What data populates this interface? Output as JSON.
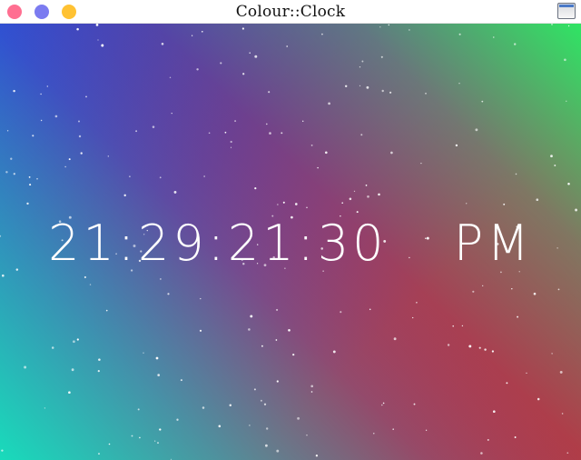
{
  "window": {
    "title": "Colour::Clock",
    "controls": {
      "close_color": "#ff6f91",
      "minimize_color": "#7b7bf0",
      "zoom_color": "#ffc233"
    },
    "icon": "window-icon"
  },
  "clock": {
    "time": "21:29:21:30",
    "period": "PM",
    "text_color": "#ffffff"
  },
  "background": {
    "gradient_colors": [
      "#3a1ed8",
      "#7c1494",
      "#d21038",
      "#12e6be",
      "#28f064"
    ],
    "star_color": "#ffffff"
  }
}
